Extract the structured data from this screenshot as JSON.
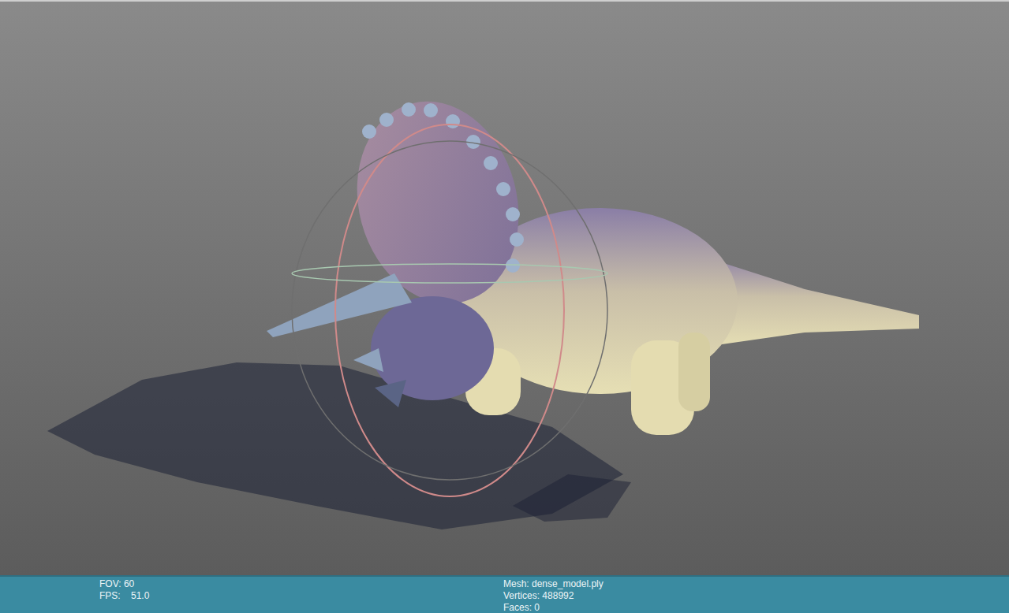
{
  "viewport": {
    "kind": "3d-point-cloud-view"
  },
  "status_bar": {
    "left": [
      "FOV: 60",
      "FPS:    51.0"
    ],
    "right": [
      "Mesh: dense_model.ply",
      "Vertices: 488992",
      "Faces: 0"
    ]
  }
}
